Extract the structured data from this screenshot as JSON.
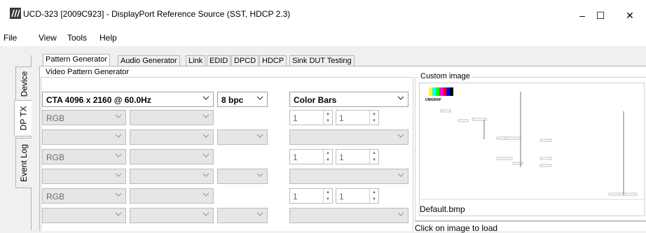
{
  "window": {
    "title": "UCD-323 [2009C923] - DisplayPort Reference Source (SST, HDCP 2.3)",
    "minimize": "–",
    "maximize": "☐",
    "close": "✕"
  },
  "menu": [
    {
      "label": "File"
    },
    {
      "label": "View"
    },
    {
      "label": "Tools"
    },
    {
      "label": "Help"
    }
  ],
  "side_tabs": [
    "Device",
    "DP TX",
    "Event Log"
  ],
  "tabs": [
    "Pattern Generator",
    "Audio Generator",
    "Link",
    "EDID",
    "DPCD",
    "HDCP",
    "Sink DUT Testing"
  ],
  "video_group": {
    "title": "Video Pattern Generator",
    "timing": "CTA 4096 x 2160 @ 60.0Hz",
    "bpc": "8 bpc",
    "pattern": "Color Bars",
    "rows": [
      {
        "color": "RGB",
        "spin_a": "1",
        "spin_b": "1"
      },
      {
        "color": "",
        "spin_a": "",
        "spin_b": ""
      },
      {
        "color": "RGB",
        "spin_a": "1",
        "spin_b": "1"
      },
      {
        "color": "",
        "spin_a": "",
        "spin_b": ""
      },
      {
        "color": "RGB",
        "spin_a": "1",
        "spin_b": "1"
      },
      {
        "color": "",
        "spin_a": "",
        "spin_b": ""
      }
    ]
  },
  "custom_image": {
    "title": "Custom image",
    "filename": "Default.bmp",
    "hint": "Click on image to load",
    "logo_text": "UNIGRAF",
    "bar_colors": [
      "#ffffff",
      "#ffff00",
      "#00ffff",
      "#00ff00",
      "#ff00ff",
      "#ff0000",
      "#0000ff",
      "#000000"
    ]
  }
}
